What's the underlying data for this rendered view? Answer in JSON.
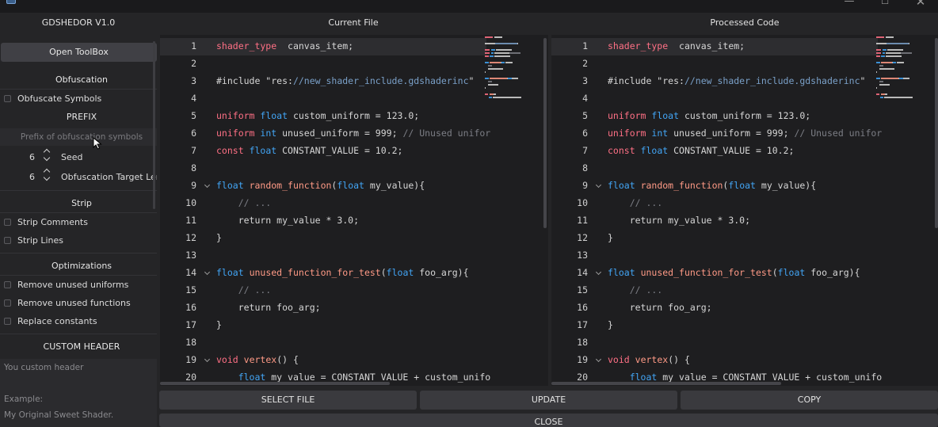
{
  "window": {
    "close_glyph": "✕",
    "maximize_glyph": "☐",
    "minimize_glyph": "—"
  },
  "header": {
    "app_title": "GDSHEDOR V1.0",
    "current_file": "Current File",
    "processed_code": "Processed Code"
  },
  "sidebar": {
    "toolbox_button": "Open ToolBox",
    "obfuscation": {
      "title": "Obfuscation",
      "obfuscate_symbols": "Obfuscate Symbols",
      "prefix_title": "PREFIX",
      "prefix_placeholder": "Prefix of obfuscation symbols",
      "seed_value": "6",
      "seed_label": "Seed",
      "target_length_value": "6",
      "target_length_label": "Obfuscation Target Length"
    },
    "strip": {
      "title": "Strip",
      "strip_comments": "Strip Comments",
      "strip_lines": "Strip Lines"
    },
    "optimizations": {
      "title": "Optimizations",
      "remove_uniforms": "Remove unused uniforms",
      "remove_functions": "Remove unused functions",
      "replace_constants": "Replace constants"
    },
    "custom_header": {
      "title": "CUSTOM HEADER",
      "placeholder": "You custom header",
      "example_label": "Example:",
      "example_text": "My Original Sweet Shader."
    }
  },
  "line_numbers": [
    "1",
    "2",
    "3",
    "4",
    "5",
    "6",
    "7",
    "8",
    "9",
    "10",
    "11",
    "12",
    "13",
    "14",
    "15",
    "16",
    "17",
    "18",
    "19",
    "20"
  ],
  "buttons": {
    "select_file": "SELECT FILE",
    "update": "UPDATE",
    "copy": "COPY",
    "close": "CLOSE"
  },
  "syntax_colors": {
    "keyword": "#ff7085",
    "type": "#42a5f5",
    "function": "#ff9a86",
    "comment": "#7c7e85",
    "string": "#7aa0c8",
    "default": "#d6d6d6"
  },
  "code_lines": [
    [
      [
        "kw",
        "shader_type"
      ],
      [
        "",
        "  canvas_item;"
      ]
    ],
    [],
    [
      [
        "",
        "#include \"res:"
      ],
      [
        "str",
        "//new_shader_include.gdshaderinc"
      ],
      [
        "",
        "\""
      ]
    ],
    [],
    [
      [
        "kw",
        "uniform"
      ],
      [
        "",
        " "
      ],
      [
        "type",
        "float"
      ],
      [
        "",
        " custom_uniform = 123.0;"
      ]
    ],
    [
      [
        "kw",
        "uniform"
      ],
      [
        "",
        " "
      ],
      [
        "type",
        "int"
      ],
      [
        "",
        " unused_uniform = 999; "
      ],
      [
        "cm",
        "// Unused unifor"
      ]
    ],
    [
      [
        "kw",
        "const"
      ],
      [
        "",
        " "
      ],
      [
        "type",
        "float"
      ],
      [
        "",
        " CONSTANT_VALUE = 10.2;"
      ]
    ],
    [],
    [
      [
        "type",
        "float"
      ],
      [
        "",
        " "
      ],
      [
        "fn",
        "random_function"
      ],
      [
        "",
        "("
      ],
      [
        "type",
        "float"
      ],
      [
        "",
        " my_value){"
      ]
    ],
    [
      [
        "cm",
        "    // ..."
      ]
    ],
    [
      [
        "",
        "    return my_value * 3.0;"
      ]
    ],
    [
      [
        "",
        "}"
      ]
    ],
    [],
    [
      [
        "type",
        "float"
      ],
      [
        "",
        " "
      ],
      [
        "fn",
        "unused_function_for_test"
      ],
      [
        "",
        "("
      ],
      [
        "type",
        "float"
      ],
      [
        "",
        " foo_arg){"
      ]
    ],
    [
      [
        "cm",
        "    // ..."
      ]
    ],
    [
      [
        "",
        "    return foo_arg;"
      ]
    ],
    [
      [
        "",
        "}"
      ]
    ],
    [],
    [
      [
        "kw",
        "void"
      ],
      [
        "",
        " "
      ],
      [
        "fn",
        "vertex"
      ],
      [
        "",
        "() {"
      ]
    ],
    [
      [
        "",
        "    "
      ],
      [
        "type",
        "float"
      ],
      [
        "",
        " my_value = CONSTANT_VALUE + custom_unifo"
      ]
    ]
  ],
  "fold_lines": [
    9,
    14,
    19
  ]
}
